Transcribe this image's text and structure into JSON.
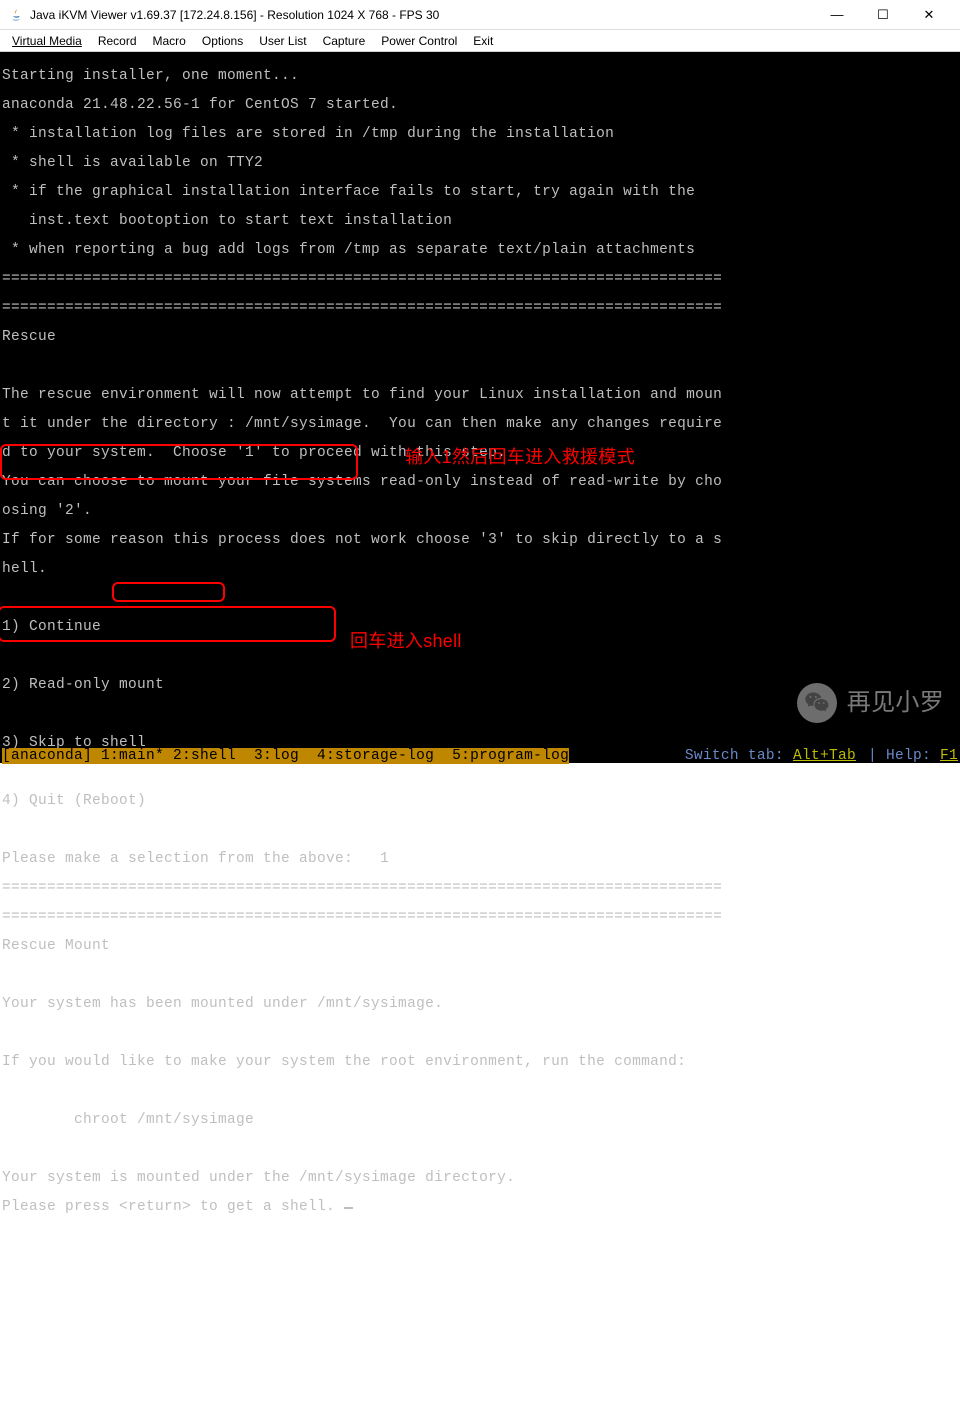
{
  "window": {
    "title": "Java iKVM Viewer v1.69.37 [172.24.8.156]  - Resolution 1024 X 768 - FPS 30",
    "controls": {
      "min": "—",
      "max": "☐",
      "close": "✕"
    }
  },
  "menu": {
    "items": [
      "Virtual Media",
      "Record",
      "Macro",
      "Options",
      "User List",
      "Capture",
      "Power Control",
      "Exit"
    ]
  },
  "terminal": {
    "lines": [
      "Starting installer, one moment...",
      "anaconda 21.48.22.56-1 for CentOS 7 started.",
      " * installation log files are stored in /tmp during the installation",
      " * shell is available on TTY2",
      " * if the graphical installation interface fails to start, try again with the",
      "   inst.text bootoption to start text installation",
      " * when reporting a bug add logs from /tmp as separate text/plain attachments",
      "================================================================================",
      "================================================================================",
      "Rescue",
      "",
      "The rescue environment will now attempt to find your Linux installation and moun",
      "t it under the directory : /mnt/sysimage.  You can then make any changes require",
      "d to your system.  Choose '1' to proceed with this step.",
      "You can choose to mount your file systems read-only instead of read-write by cho",
      "osing '2'.",
      "If for some reason this process does not work choose '3' to skip directly to a s",
      "hell.",
      "",
      "1) Continue",
      "",
      "2) Read-only mount",
      "",
      "3) Skip to shell",
      "",
      "4) Quit (Reboot)",
      "",
      "Please make a selection from the above:   1",
      "================================================================================",
      "================================================================================",
      "Rescue Mount",
      "",
      "Your system has been mounted under /mnt/sysimage.",
      "",
      "If you would like to make your system the root environment, run the command:",
      "",
      "\tchroot /mnt/sysimage",
      "",
      "Your system is mounted under the /mnt/sysimage directory.",
      "Please press <return> to get a shell."
    ],
    "status_left_prefix": "[anaconda]",
    "status_left_rest": " 1:main* 2:shell  3:log  4:storage-log  5:program-log",
    "status_switch": "Switch tab: ",
    "status_switch_key": "Alt+Tab",
    "status_help": "Help: ",
    "status_help_key": "F1"
  },
  "annotations": {
    "note1": "输入1然后回车进入救援模式",
    "note2": "回车进入shell"
  },
  "overlay": {
    "wechat_text": "再见小罗"
  }
}
